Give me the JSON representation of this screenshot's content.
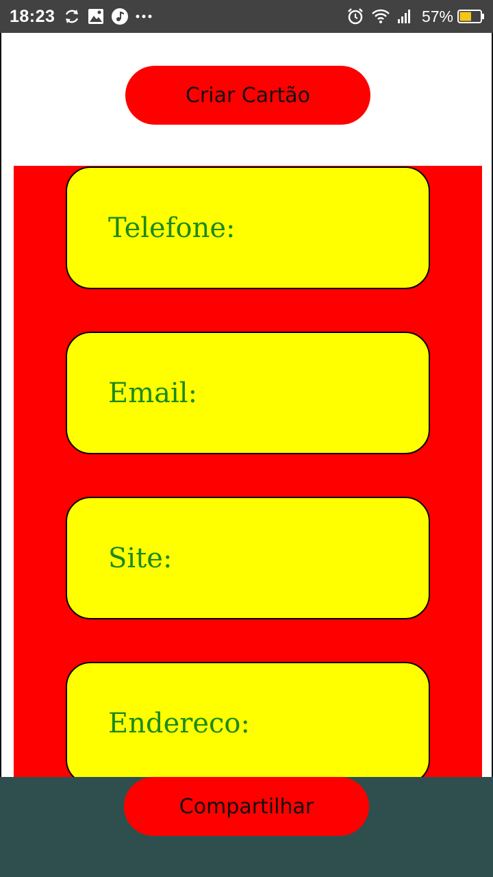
{
  "status_bar": {
    "time": "18:23",
    "left_icons": [
      "sync-icon",
      "image-icon",
      "music-icon",
      "more-icon"
    ],
    "right_icons": [
      "alarm-icon",
      "wifi-icon",
      "signal-icon"
    ],
    "battery_percent": "57%",
    "battery_level": 0.57
  },
  "header": {
    "create_label": "Criar Cartão"
  },
  "card": {
    "fields": [
      {
        "label": "Telefone:"
      },
      {
        "label": "Email:"
      },
      {
        "label": "Site:"
      },
      {
        "label": "Endereco:"
      }
    ]
  },
  "footer": {
    "share_label": "Compartilhar"
  },
  "colors": {
    "button": "#ff0000",
    "panel": "#ff0000",
    "field_bg": "#ffff00",
    "field_text": "#1b8a1b",
    "footer_bg": "#2f4f4f",
    "status_bar": "#424242"
  }
}
